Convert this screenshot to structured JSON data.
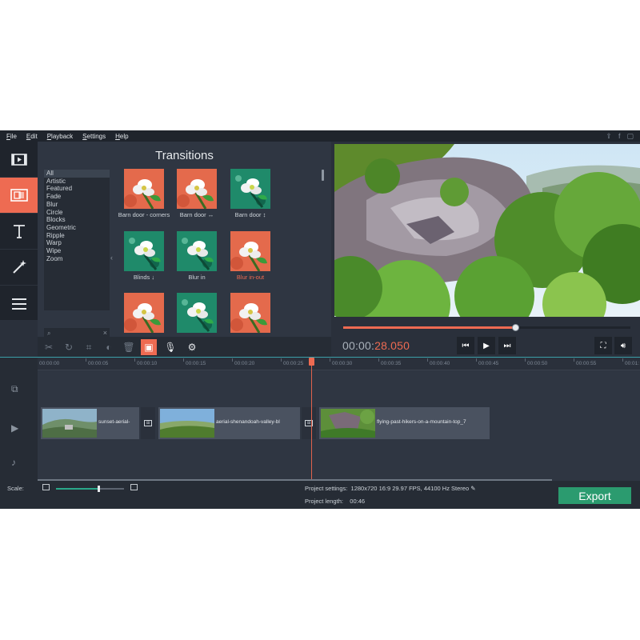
{
  "menu": [
    "File",
    "Edit",
    "Playback",
    "Settings",
    "Help"
  ],
  "social_icons": [
    "share-icon",
    "facebook-icon",
    "window-icon"
  ],
  "rail": [
    {
      "name": "media-icon",
      "active": false
    },
    {
      "name": "transitions-icon",
      "active": true
    },
    {
      "name": "titles-icon",
      "active": false
    },
    {
      "name": "filters-wand-icon",
      "active": false
    },
    {
      "name": "more-menu-icon",
      "active": false
    }
  ],
  "transitions": {
    "title": "Transitions",
    "categories": [
      "All",
      "Artistic",
      "Featured",
      "Fade",
      "Blur",
      "Circle",
      "Blocks",
      "Geometric",
      "Ripple",
      "Warp",
      "Wipe",
      "Zoom"
    ],
    "selected_category": "All",
    "items": [
      {
        "label": "Barn door - corners",
        "highlight": false
      },
      {
        "label": "Barn door ↔",
        "highlight": false
      },
      {
        "label": "Barn door ↕",
        "highlight": false
      },
      {
        "label": "Blinds ↓",
        "highlight": false
      },
      {
        "label": "Blur in",
        "highlight": false
      },
      {
        "label": "Blur in-out",
        "highlight": true
      },
      {
        "label": "",
        "highlight": false
      },
      {
        "label": "",
        "highlight": false
      },
      {
        "label": "",
        "highlight": false
      }
    ]
  },
  "player": {
    "timecode_main": "00:00:",
    "timecode_ms": "28.050",
    "progress": 0.6,
    "buttons": [
      "skip-back-icon",
      "play-icon",
      "skip-forward-icon"
    ],
    "right_buttons": [
      "fullscreen-icon",
      "volume-icon"
    ]
  },
  "toolbar": [
    "cut-icon",
    "rotate-icon",
    "crop-icon",
    "color-adjust-icon",
    "delete-icon",
    "clip-properties-icon",
    "microphone-icon",
    "settings-gear-icon"
  ],
  "timeline": {
    "ruler": [
      "00:00:00",
      "00:00:05",
      "00:00:10",
      "00:00:15",
      "00:00:20",
      "00:00:25",
      "00:00:30",
      "00:00:35",
      "00:00:40",
      "00:00:45",
      "00:00:50",
      "00:00:55",
      "00:01:"
    ],
    "clips": [
      {
        "label": "sunset-aerial-",
        "scene": "hill"
      },
      {
        "label": "aerial-shenandoah-valley-bl",
        "scene": "valley"
      },
      {
        "label": "flying-past-hikers-on-a-mountain-top_7",
        "scene": "rock"
      }
    ],
    "track_icons": [
      "overlay-track-icon",
      "video-track-icon",
      "audio-track-icon"
    ]
  },
  "status": {
    "scale_label": "Scale:",
    "zoom": 0.62,
    "project_settings_label": "Project settings:",
    "project_settings_value": "1280x720 16:9 29.97 FPS, 44100 Hz Stereo",
    "project_length_label": "Project length:",
    "project_length_value": "00:46",
    "export_label": "Export"
  },
  "colors": {
    "accent": "#ee6b52",
    "export": "#2b9b6f",
    "bg": "#2a303b"
  }
}
